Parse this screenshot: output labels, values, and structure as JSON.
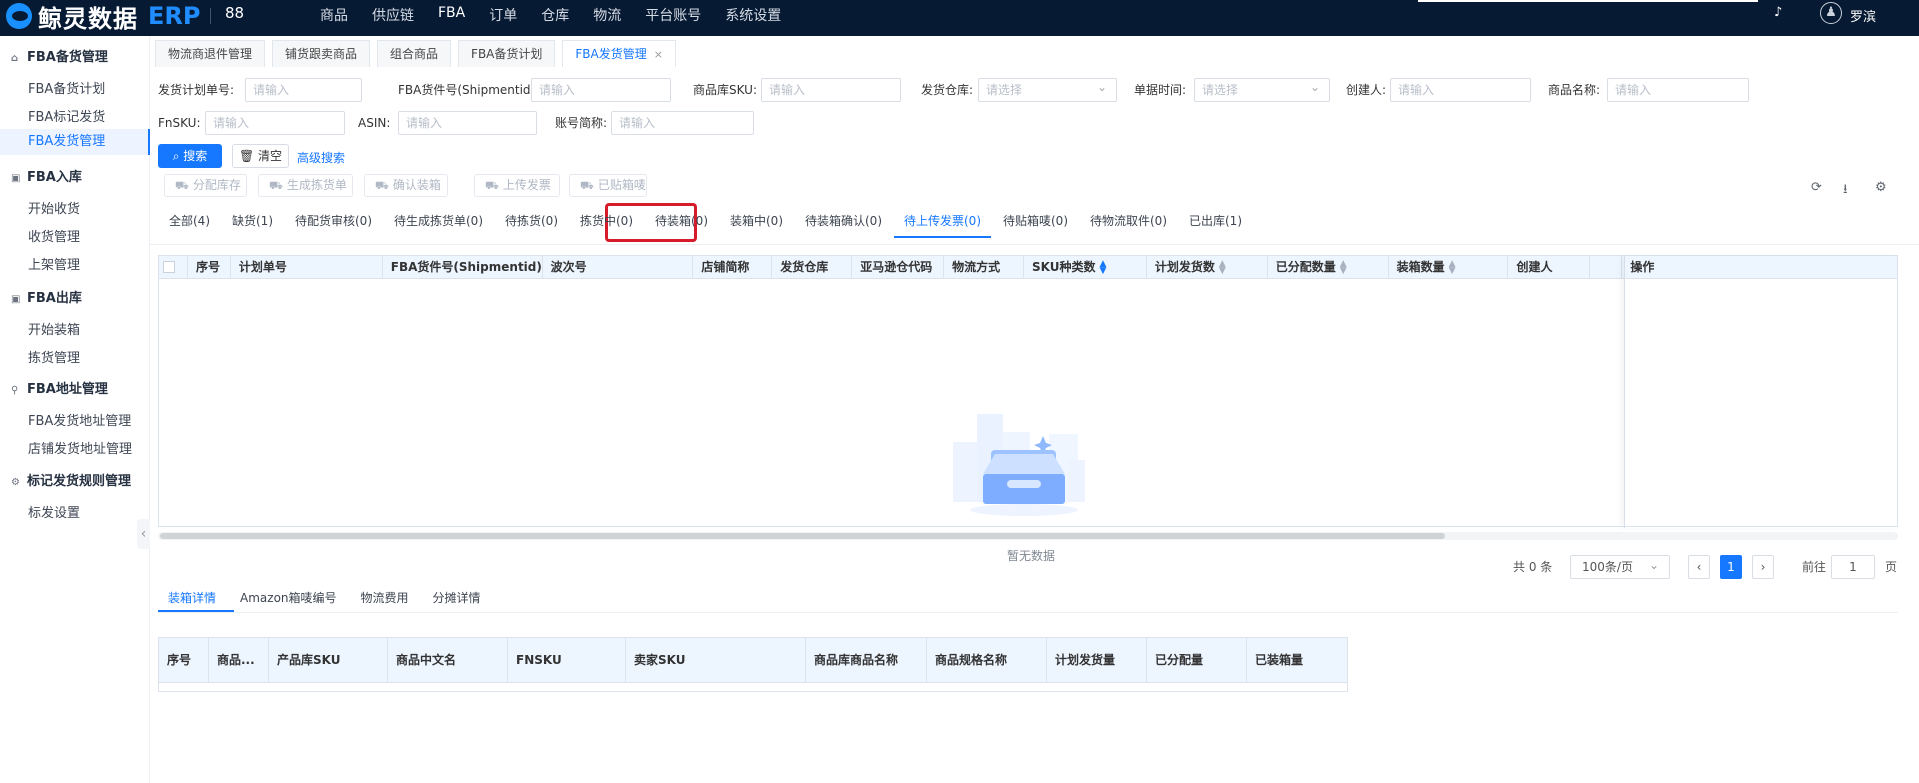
{
  "header": {
    "logo_text": "鲸灵数据",
    "logo_erp": "ERP",
    "nav": [
      "商品",
      "供应链",
      "FBA",
      "订单",
      "仓库",
      "物流",
      "平台账号",
      "系统设置"
    ],
    "user": "罗滨"
  },
  "sidebar": {
    "groups": [
      {
        "label": "FBA备货管理",
        "icon": "⌂",
        "items": [
          "FBA备货计划",
          "FBA标记发货",
          "FBA发货管理"
        ]
      },
      {
        "label": "FBA入库",
        "icon": "▣",
        "items": [
          "开始收货",
          "收货管理",
          "上架管理"
        ]
      },
      {
        "label": "FBA出库",
        "icon": "▣",
        "items": [
          "开始装箱",
          "拣货管理"
        ]
      },
      {
        "label": "FBA地址管理",
        "icon": "⚲",
        "items": [
          "FBA发货地址管理",
          "店铺发货地址管理"
        ]
      },
      {
        "label": "标记发货规则管理",
        "icon": "⚙",
        "items": [
          "标发设置"
        ]
      }
    ]
  },
  "tabs": [
    "物流商退件管理",
    "铺货跟卖商品",
    "组合商品",
    "FBA备货计划",
    "FBA发货管理"
  ],
  "filters": {
    "plan_no": "发货计划单号:",
    "shipment": "FBA货件号(Shipmentid):",
    "sku": "商品库SKU:",
    "warehouse": "发货仓库:",
    "doc_time": "单据时间:",
    "creator": "创建人:",
    "product_name": "商品名称:",
    "fnsku": "FnSKU:",
    "asin": "ASIN:",
    "account": "账号简称:",
    "placeholder_input": "请输入",
    "placeholder_select": "请选择"
  },
  "buttons": {
    "search": "搜索",
    "clear": "清空",
    "advanced": "高级搜索",
    "actions": [
      "分配库存",
      "生成拣货单",
      "确认装箱",
      "上传发票",
      "已贴箱唛"
    ]
  },
  "status_tabs": [
    "全部(4)",
    "缺货(1)",
    "待配货审核(0)",
    "待生成拣货单(0)",
    "待拣货(0)",
    "拣货中(0)",
    "待装箱(0)",
    "装箱中(0)",
    "待装箱确认(0)",
    "待上传发票(0)",
    "待贴箱唛(0)",
    "待物流取件(0)",
    "已出库(1)"
  ],
  "table": {
    "columns": [
      "序号",
      "计划单号",
      "FBA货件号(Shipmentid)",
      "波次号",
      "店铺简称",
      "发货仓库",
      "亚马逊仓代码",
      "物流方式",
      "SKU种类数",
      "计划发货数",
      "已分配数量",
      "装箱数量",
      "创建人",
      "",
      "操作"
    ],
    "empty": "暂无数据"
  },
  "pagination": {
    "total": "共 0 条",
    "page_size": "100条/页",
    "current_page": "1",
    "goto": "前往",
    "goto_value": "1",
    "page_unit": "页"
  },
  "bottom_tabs": [
    "装箱详情",
    "Amazon箱唛编号",
    "物流费用",
    "分摊详情"
  ],
  "bottom_table": {
    "columns": [
      "序号",
      "商品...",
      "产品库SKU",
      "商品中文名",
      "FNSKU",
      "卖家SKU",
      "商品库商品名称",
      "商品规格名称",
      "计划发货量",
      "已分配量",
      "已装箱量"
    ]
  }
}
